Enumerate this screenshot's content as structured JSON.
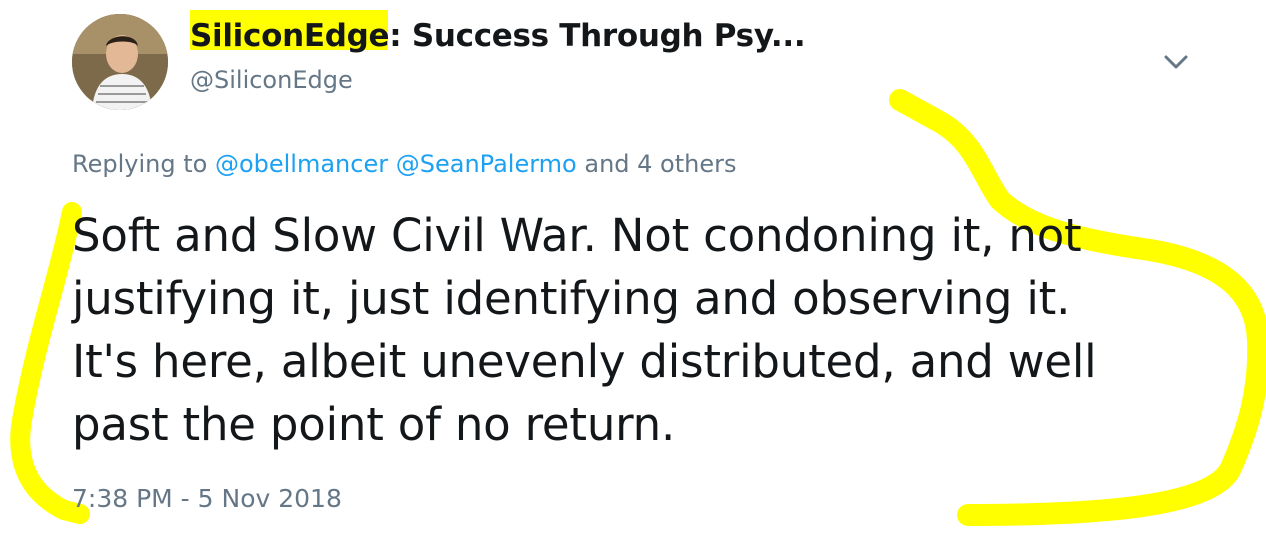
{
  "tweet": {
    "display_name": "SiliconEdge: Success Through Psy...",
    "handle": "@SiliconEdge",
    "reply_prefix": "Replying to",
    "reply_mentions": [
      "@obellmancer",
      "@SeanPalermo"
    ],
    "reply_suffix": "and 4 others",
    "text_lines": [
      "Soft and Slow Civil War. Not condoning it, not",
      "justifying it, just identifying and observing it.",
      "It's here, albeit unevenly distributed, and well",
      "past the point of no return."
    ],
    "timestamp": "7:38 PM - 5 Nov 2018",
    "menu_icon": "chevron-down-icon",
    "avatar_icon": "avatar"
  },
  "colors": {
    "text": "#14171a",
    "secondary": "#657786",
    "link": "#1da1f2",
    "highlighter": "#ffff00"
  }
}
